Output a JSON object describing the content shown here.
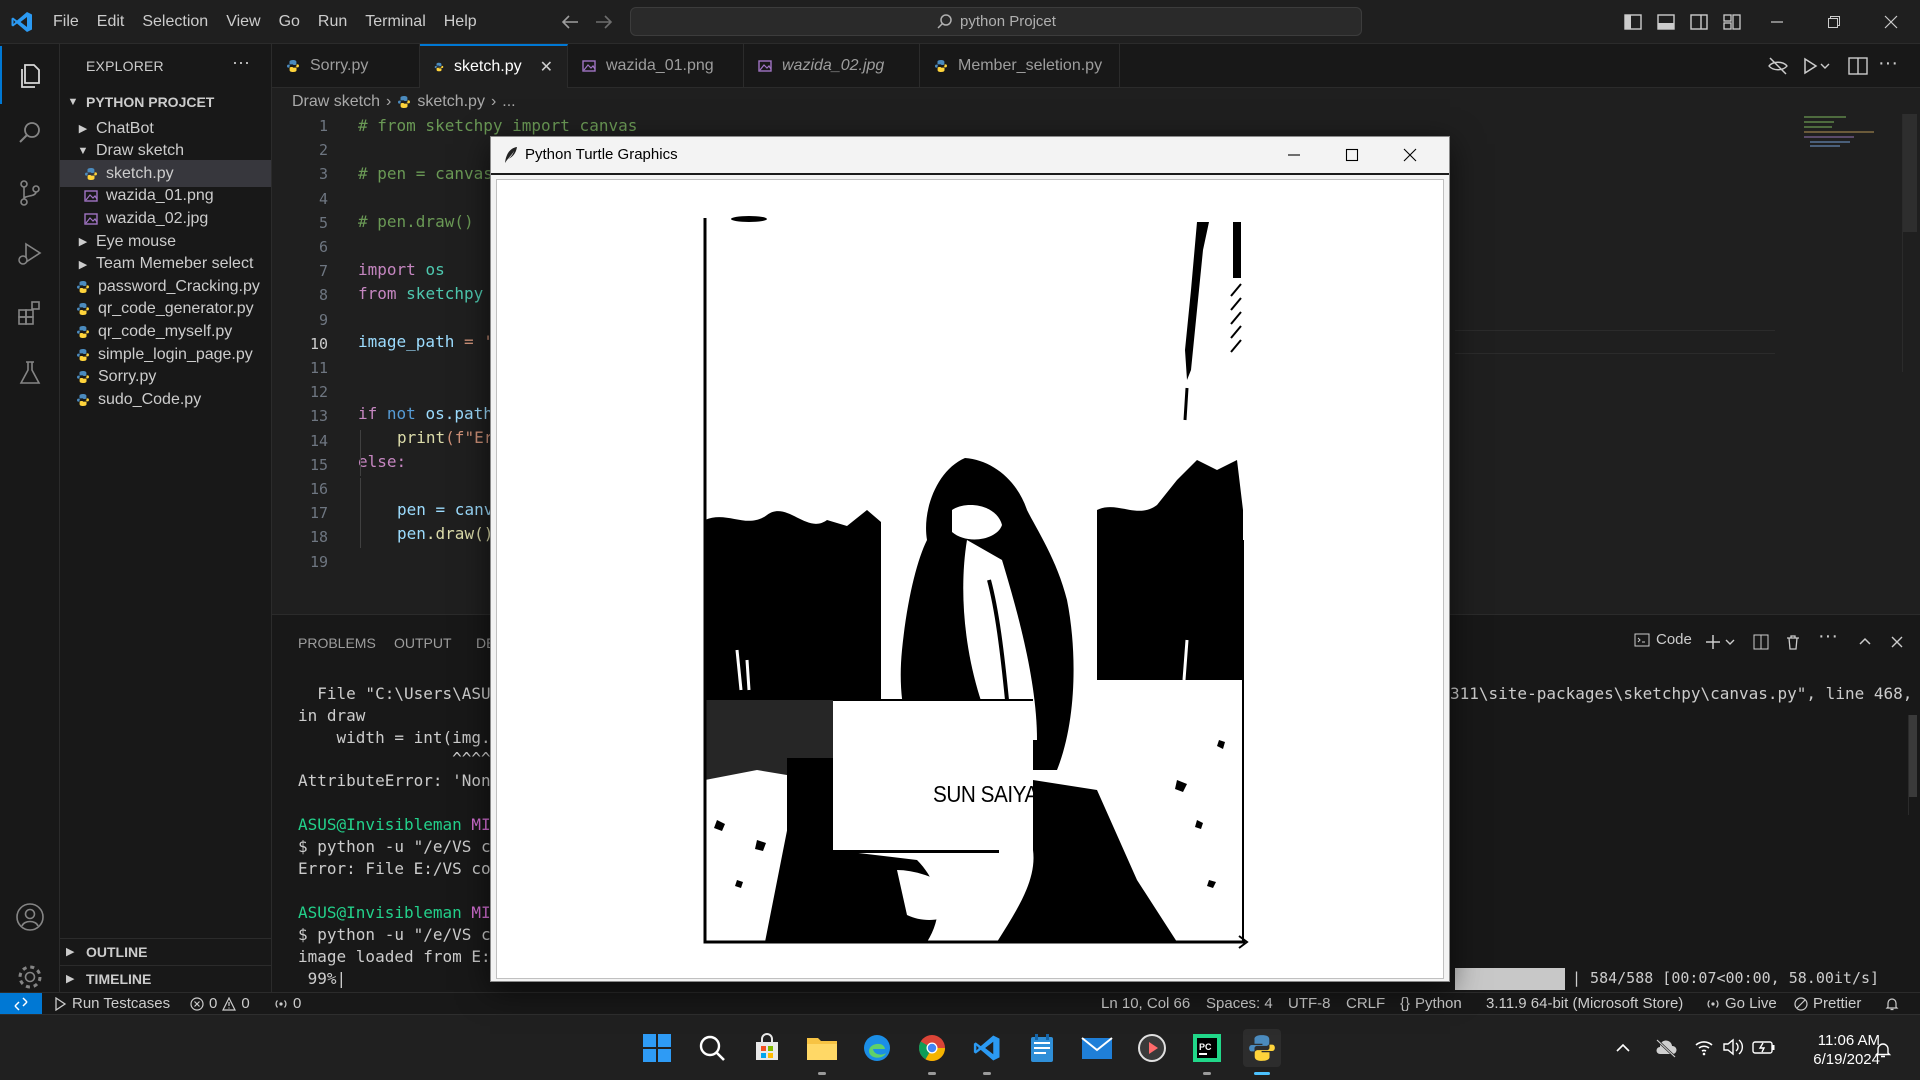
{
  "menu": [
    "File",
    "Edit",
    "Selection",
    "View",
    "Go",
    "Run",
    "Terminal",
    "Help"
  ],
  "command_center": {
    "text": "python Projcet"
  },
  "explorer": {
    "title": "EXPLORER",
    "root": "PYTHON PROJCET",
    "items": [
      {
        "label": "ChatBot",
        "type": "folder",
        "expanded": false
      },
      {
        "label": "Draw sketch",
        "type": "folder",
        "expanded": true
      },
      {
        "label": "sketch.py",
        "type": "py",
        "selected": true
      },
      {
        "label": "wazida_01.png",
        "type": "img"
      },
      {
        "label": "wazida_02.jpg",
        "type": "img"
      },
      {
        "label": "Eye mouse",
        "type": "folder",
        "expanded": false
      },
      {
        "label": "Team Memeber select",
        "type": "folder",
        "expanded": false
      },
      {
        "label": "password_Cracking.py",
        "type": "py"
      },
      {
        "label": "qr_code_generator.py",
        "type": "py"
      },
      {
        "label": "qr_code_myself.py",
        "type": "py"
      },
      {
        "label": "simple_login_page.py",
        "type": "py"
      },
      {
        "label": "Sorry.py",
        "type": "py"
      },
      {
        "label": "sudo_Code.py",
        "type": "py"
      }
    ],
    "outline": "OUTLINE",
    "timeline": "TIMELINE"
  },
  "tabs": [
    {
      "label": "Sorry.py",
      "icon": "python-file-icon"
    },
    {
      "label": "sketch.py",
      "icon": "python-file-icon",
      "active": true
    },
    {
      "label": "wazida_01.png",
      "icon": "image-file-icon"
    },
    {
      "label": "wazida_02.jpg",
      "icon": "image-file-icon"
    },
    {
      "label": "Member_seletion.py",
      "icon": "python-file-icon"
    }
  ],
  "breadcrumb": {
    "folder": "Draw sketch",
    "file": "sketch.py",
    "more": "..."
  },
  "code": {
    "line_numbers": [
      "1",
      "2",
      "3",
      "4",
      "5",
      "6",
      "7",
      "8",
      "9",
      "10",
      "11",
      "12",
      "13",
      "14",
      "15",
      "16",
      "17",
      "18",
      "19"
    ],
    "current_line": "10",
    "l1": "# from sketchpy import canvas",
    "l3": "# pen = canvas",
    "l5": "# pen.draw()",
    "l7_kw": "import",
    "l7_mod": "os",
    "l8_kw": "from",
    "l8_mod": "sketchpy",
    "l10_var": "image_path",
    "l10_op": " = '",
    "l13_kw": "if",
    "l13_kw2": "not",
    "l13_rest": "os.path",
    "l14_fn": "print",
    "l14_rest": "(f\"Er",
    "l15": "else:",
    "l17_var": "pen",
    "l17_rest": " = canv",
    "l18_var": "pen",
    "l18_rest": ".draw()"
  },
  "panel": {
    "tabs": [
      "PROBLEMS",
      "OUTPUT",
      "DE"
    ],
    "terminal_label": "Code",
    "lines": {
      "t1": "  File \"C:\\Users\\ASUS",
      "t1r": "311\\site-packages\\sketchpy\\canvas.py\", line 468,",
      "t2": "in draw",
      "t3": "    width = int(img.sl",
      "t4": "                ^^^^^",
      "t5": "AttributeError: 'None",
      "t6a": "ASUS@Invisibleman",
      "t6b": "MIN",
      "t7": "$ python -u \"/e/VS co",
      "t8": "Error: File E:/VS code",
      "t9a": "ASUS@Invisibleman",
      "t9b": "MIN",
      "t10": "$ python -u \"/e/VS co",
      "t11": "image loaded from E:\\",
      "t12": " 99%|",
      "t12r": "| 584/588 [00:07<00:00, 58.00it/s]"
    },
    "progress": 0.99
  },
  "status": {
    "run_testcases": "Run Testcases",
    "errors": "0",
    "warnings": "0",
    "ports": "0",
    "position": "Ln 10, Col 66",
    "spaces": "Spaces: 4",
    "encoding": "UTF-8",
    "eol": "CRLF",
    "language": "Python",
    "interpreter": "3.11.9 64-bit (Microsoft Store)",
    "golive": "Go Live",
    "prettier": "Prettier"
  },
  "turtle_window": {
    "title": "Python Turtle Graphics",
    "sketch_text": "SUN SAIYAN"
  },
  "taskbar": {
    "time": "11:06 AM",
    "date": "6/19/2024"
  },
  "colors": {
    "accent": "#0078d4",
    "editor_bg": "#1f1f1f",
    "sidebar_bg": "#181818",
    "comment": "#6a9955",
    "keyword": "#569cd6",
    "terminal_green": "#23d18b",
    "terminal_magenta": "#d670d6"
  }
}
